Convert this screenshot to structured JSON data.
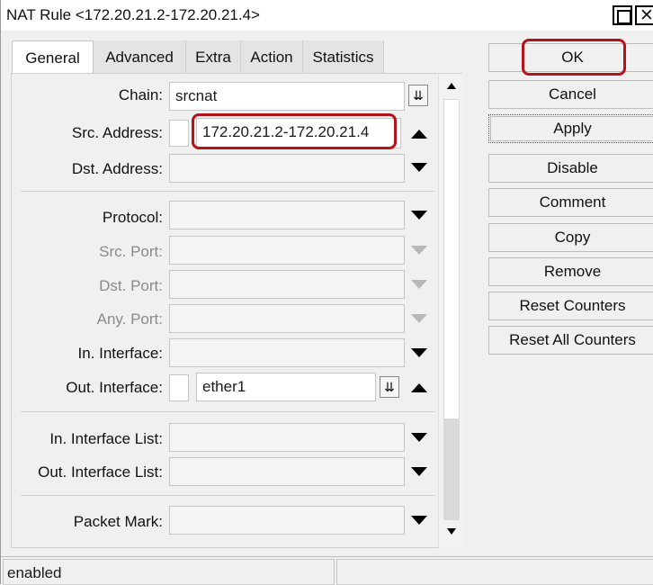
{
  "window": {
    "title": "NAT Rule <172.20.21.2-172.20.21.4>"
  },
  "tabs": [
    {
      "label": "General"
    },
    {
      "label": "Advanced"
    },
    {
      "label": "Extra"
    },
    {
      "label": "Action"
    },
    {
      "label": "Statistics"
    }
  ],
  "active_tab": "General",
  "form": {
    "chain": {
      "label": "Chain:",
      "value": "srcnat"
    },
    "src_address": {
      "label": "Src. Address:",
      "value": "172.20.21.2-172.20.21.4"
    },
    "dst_address": {
      "label": "Dst. Address:",
      "value": ""
    },
    "protocol": {
      "label": "Protocol:",
      "value": ""
    },
    "src_port": {
      "label": "Src. Port:",
      "value": ""
    },
    "dst_port": {
      "label": "Dst. Port:",
      "value": ""
    },
    "any_port": {
      "label": "Any. Port:",
      "value": ""
    },
    "in_interface": {
      "label": "In. Interface:",
      "value": ""
    },
    "out_interface": {
      "label": "Out. Interface:",
      "value": "ether1"
    },
    "in_interface_list": {
      "label": "In. Interface List:",
      "value": ""
    },
    "out_interface_list": {
      "label": "Out. Interface List:",
      "value": ""
    },
    "packet_mark": {
      "label": "Packet Mark:",
      "value": ""
    }
  },
  "buttons": {
    "ok": "OK",
    "cancel": "Cancel",
    "apply": "Apply",
    "disable": "Disable",
    "comment": "Comment",
    "copy": "Copy",
    "remove": "Remove",
    "reset_counters": "Reset Counters",
    "reset_all_counters": "Reset All Counters"
  },
  "status": {
    "state": "enabled"
  },
  "icons": {
    "dropdown_down": "triangle-down-icon",
    "collapse_up": "triangle-up-icon",
    "select_arrow": "select-dropdown-icon"
  },
  "colors": {
    "highlight": "#b5121b"
  }
}
